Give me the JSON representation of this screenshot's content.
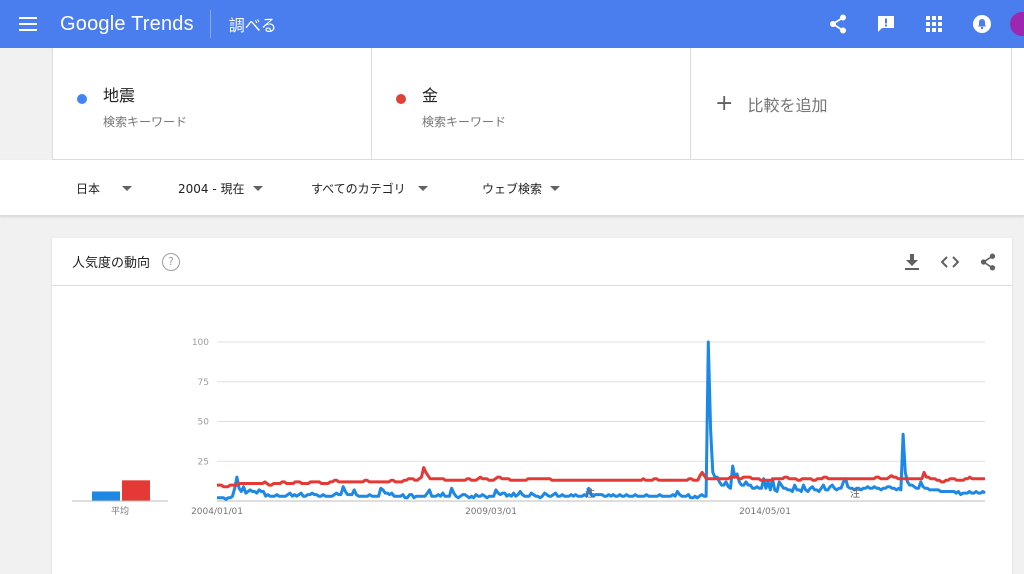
{
  "header": {
    "logo": "Google Trends",
    "page": "調べる"
  },
  "terms": [
    {
      "name": "地震",
      "sub": "検索キーワード",
      "color": "#4285f4"
    },
    {
      "name": "金",
      "sub": "検索キーワード",
      "color": "#db4437"
    }
  ],
  "add_compare": "比較を追加",
  "filters": {
    "region": "日本",
    "time": "2004 - 現在",
    "category": "すべてのカテゴリ",
    "search_type": "ウェブ検索"
  },
  "card": {
    "title": "人気度の動向",
    "help": "?"
  },
  "chart_data": {
    "type": "line",
    "x_tick_labels": [
      "2004/01/01",
      "2009/03/01",
      "2014/05/01"
    ],
    "ylim": [
      0,
      100
    ],
    "yticks": [
      25,
      50,
      75,
      100
    ],
    "grid": true,
    "average_label": "平均",
    "averages": [
      6,
      13
    ],
    "series": [
      {
        "name": "地震",
        "color": "#1e88e5",
        "values": [
          2,
          2,
          2,
          2,
          1,
          2,
          2,
          3,
          8,
          15,
          8,
          6,
          9,
          5,
          6,
          7,
          6,
          6,
          5,
          7,
          6,
          6,
          3,
          4,
          3,
          3,
          3,
          4,
          3,
          3,
          3,
          3,
          4,
          5,
          3,
          4,
          3,
          4,
          5,
          3,
          3,
          4,
          4,
          5,
          4,
          4,
          3,
          3,
          4,
          3,
          3,
          3,
          3,
          4,
          5,
          4,
          4,
          9,
          6,
          4,
          4,
          4,
          7,
          4,
          3,
          3,
          3,
          3,
          3,
          4,
          3,
          3,
          3,
          3,
          8,
          7,
          5,
          5,
          4,
          5,
          3,
          3,
          3,
          3,
          4,
          2,
          2,
          4,
          4,
          2,
          3,
          3,
          3,
          3,
          3,
          5,
          7,
          3,
          3,
          3,
          4,
          3,
          5,
          3,
          3,
          3,
          8,
          5,
          3,
          2,
          3,
          4,
          4,
          3,
          2,
          3,
          2,
          4,
          3,
          3,
          4,
          3,
          2,
          3,
          3,
          3,
          7,
          5,
          4,
          5,
          5,
          3,
          4,
          3,
          5,
          3,
          4,
          6,
          4,
          3,
          3,
          3,
          5,
          4,
          3,
          3,
          2,
          3,
          5,
          4,
          3,
          3,
          4,
          5,
          3,
          3,
          4,
          3,
          3,
          3,
          4,
          3,
          4,
          3,
          3,
          3,
          4,
          3,
          8,
          4,
          3,
          4,
          4,
          4,
          4,
          3,
          3,
          4,
          3,
          4,
          3,
          3,
          4,
          3,
          3,
          4,
          3,
          3,
          3,
          4,
          3,
          3,
          3,
          3,
          4,
          3,
          3,
          3,
          3,
          3,
          4,
          3,
          3,
          3,
          3,
          3,
          4,
          3,
          6,
          4,
          3,
          3,
          3,
          4,
          2,
          2,
          3,
          2,
          3,
          4,
          3,
          3,
          100,
          45,
          18,
          15,
          15,
          12,
          10,
          10,
          12,
          9,
          8,
          22,
          15,
          17,
          12,
          10,
          10,
          12,
          10,
          10,
          8,
          8,
          9,
          8,
          8,
          14,
          8,
          12,
          7,
          14,
          7,
          6,
          12,
          10,
          8,
          8,
          7,
          7,
          6,
          10,
          7,
          7,
          6,
          10,
          7,
          6,
          8,
          9,
          7,
          7,
          6,
          8,
          10,
          7,
          7,
          9,
          10,
          8,
          7,
          8,
          8,
          12,
          14,
          9,
          8,
          8,
          7,
          8,
          8,
          7,
          8,
          8,
          9,
          8,
          8,
          9,
          8,
          8,
          7,
          8,
          8,
          9,
          9,
          8,
          8,
          7,
          8,
          7,
          42,
          18,
          12,
          10,
          10,
          9,
          8,
          8,
          12,
          9,
          8,
          8,
          7,
          7,
          7,
          7,
          7,
          6,
          6,
          6,
          6,
          6,
          6,
          6,
          5,
          6,
          4,
          5,
          5,
          5,
          6,
          5,
          5,
          6,
          5,
          5,
          6,
          5
        ]
      },
      {
        "name": "金",
        "color": "#e53935",
        "values": [
          10,
          10,
          10,
          9,
          9,
          9,
          10,
          10,
          10,
          10,
          11,
          11,
          11,
          11,
          11,
          11,
          11,
          11,
          11,
          11,
          11,
          11,
          12,
          11,
          10,
          10,
          11,
          11,
          11,
          11,
          12,
          12,
          11,
          11,
          11,
          11,
          12,
          12,
          12,
          11,
          11,
          11,
          11,
          12,
          12,
          12,
          12,
          12,
          11,
          11,
          11,
          11,
          12,
          12,
          13,
          13,
          12,
          12,
          12,
          12,
          12,
          12,
          12,
          12,
          12,
          12,
          12,
          12,
          13,
          13,
          12,
          12,
          12,
          12,
          12,
          12,
          12,
          12,
          12,
          12,
          13,
          13,
          12,
          12,
          12,
          12,
          13,
          13,
          14,
          14,
          14,
          13,
          13,
          14,
          15,
          21,
          18,
          16,
          14,
          14,
          14,
          14,
          14,
          14,
          14,
          13,
          13,
          13,
          13,
          13,
          13,
          13,
          13,
          13,
          13,
          14,
          14,
          13,
          13,
          13,
          14,
          15,
          14,
          14,
          14,
          13,
          13,
          13,
          14,
          15,
          15,
          14,
          14,
          14,
          14,
          13,
          13,
          13,
          13,
          13,
          13,
          13,
          13,
          14,
          14,
          14,
          14,
          14,
          14,
          14,
          14,
          14,
          14,
          14,
          13,
          13,
          13,
          13,
          13,
          13,
          13,
          13,
          13,
          13,
          13,
          13,
          13,
          13,
          13,
          13,
          13,
          13,
          13,
          13,
          13,
          13,
          13,
          13,
          13,
          13,
          13,
          13,
          13,
          13,
          13,
          13,
          13,
          13,
          13,
          13,
          13,
          13,
          13,
          13,
          13,
          13,
          14,
          13,
          13,
          13,
          13,
          14,
          14,
          13,
          13,
          13,
          13,
          13,
          13,
          13,
          13,
          13,
          13,
          13,
          13,
          13,
          13,
          14,
          14,
          13,
          13,
          13,
          16,
          18,
          16,
          14,
          14,
          14,
          14,
          14,
          14,
          14,
          14,
          14,
          14,
          14,
          15,
          15,
          15,
          15,
          14,
          14,
          15,
          15,
          15,
          15,
          14,
          14,
          14,
          14,
          13,
          13,
          13,
          13,
          13,
          13,
          14,
          14,
          14,
          14,
          14,
          15,
          15,
          14,
          14,
          14,
          14,
          13,
          13,
          14,
          14,
          14,
          14,
          14,
          13,
          13,
          14,
          14,
          14,
          15,
          15,
          14,
          14,
          14,
          14,
          14,
          14,
          14,
          14,
          14,
          14,
          14,
          14,
          14,
          14,
          14,
          14,
          14,
          14,
          14,
          14,
          14,
          14,
          15,
          15,
          14,
          14,
          14,
          14,
          15,
          16,
          15,
          15,
          14,
          14,
          14,
          14,
          14,
          14,
          14,
          14,
          14,
          14,
          14,
          14,
          18,
          15,
          15,
          14,
          14,
          14,
          13,
          13,
          12,
          12,
          13,
          13,
          14,
          14,
          14,
          13,
          13,
          13,
          13,
          14,
          14,
          15,
          14,
          14,
          14,
          14,
          14,
          14,
          14
        ]
      }
    ],
    "annotations": [
      "注",
      "注"
    ]
  }
}
